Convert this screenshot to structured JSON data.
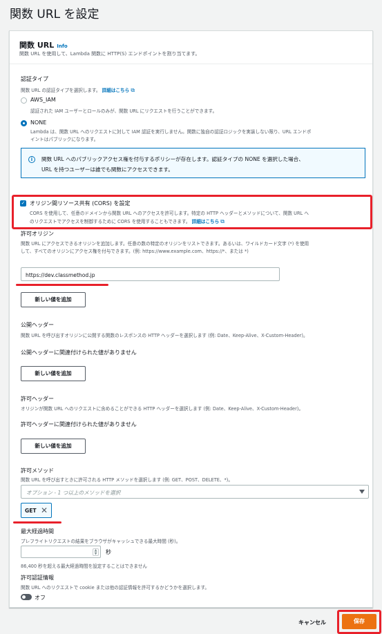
{
  "page": {
    "title": "関数 URL を設定"
  },
  "panel": {
    "title": "関数 URL",
    "info": "Info",
    "description": "関数 URL を使用して、Lambda 関数に HTTP(S) エンドポイントを割り当てます。"
  },
  "auth": {
    "label": "認証タイプ",
    "description": "関数 URL の認証タイプを選択します。",
    "learn_more": "詳細はこちら",
    "options": [
      {
        "label": "AWS_IAM",
        "description": "認証された IAM ユーザーとロールのみが、関数 URL にリクエストを行うことができます。",
        "selected": false
      },
      {
        "label": "NONE",
        "description_line1": "Lambda は、関数 URL へのリクエストに対して IAM 認証を実行しません。関数に独自の認証ロジックを実装しない限り、URL エンドポ",
        "description_line2": "イントはパブリックになります。",
        "selected": true
      }
    ],
    "alert_line1": "関数 URL へのパブリックアクセス権を付与するポリシーが存在します。認証タイプの NONE を選択した場合、",
    "alert_line2": "URL を持つユーザーは誰でも関数にアクセスできます。"
  },
  "cors": {
    "checked": true,
    "label": "オリジン間リソース共有 (CORS) を設定",
    "description_line1": "CORS を使用して、任意のドメインから関数 URL へのアクセスを許可します。特定の HTTP ヘッダーとメソッドについて、関数 URL へ",
    "description_line2": "のリクエストでアクセスを制御するために CORS を使用することもできます。",
    "learn_more": "詳細はこちら"
  },
  "allow_origins": {
    "label": "許可オリジン",
    "description_line1": "関数 URL にアクセスできるオリジンを追加します。任意の数の特定のオリジンをリストできます。あるいは、ワイルドカード文字 (*) を使用",
    "description_line2": "して、すべてのオリジンにアクセス権を付与できます。(例: https://www.example.com、https://*、または *)",
    "value": "https://dev.classmethod.jp",
    "add_button": "新しい値を追加"
  },
  "expose_headers": {
    "label": "公開ヘッダー",
    "description": "関数 URL を呼び出すオリジンに公開する関数のレスポンスの HTTP ヘッダーを選択します (例: Date、Keep-Alive、X-Custom-Header)。",
    "empty": "公開ヘッダーに関連付けられた値がありません",
    "add_button": "新しい値を追加"
  },
  "allow_headers": {
    "label": "許可ヘッダー",
    "description": "オリジンが関数 URL へのリクエストに含めることができる HTTP ヘッダーを選択します (例: Date、Keep-Alive、X-Custom-Header)。",
    "empty": "許可ヘッダーに関連付けられた値がありません",
    "add_button": "新しい値を追加"
  },
  "allow_methods": {
    "label": "許可メソッド",
    "description": "関数 URL を呼び出すときに許可される HTTP メソッドを選択します (例: GET、POST、DELETE、*)。",
    "placeholder": "オプション - 1 つ以上のメソッドを選択",
    "selected": [
      "GET"
    ]
  },
  "max_age": {
    "label": "最大経過時間",
    "description": "プレフライトリクエストの結果をブラウザがキャッシュできる最大時間 (秒)。",
    "value": "",
    "unit": "秒",
    "constraint": "86,400 秒を超える最大経過時間を設定することはできません"
  },
  "allow_credentials": {
    "label": "許可認証情報",
    "description": "関数 URL へのリクエストで cookie または他の認証情報を許可するかどうかを選択します。",
    "state": "オフ"
  },
  "footer": {
    "cancel": "キャンセル",
    "save": "保存"
  },
  "colors": {
    "accent": "#0073bb",
    "primary": "#ec7211",
    "annotation": "#e8202a"
  }
}
